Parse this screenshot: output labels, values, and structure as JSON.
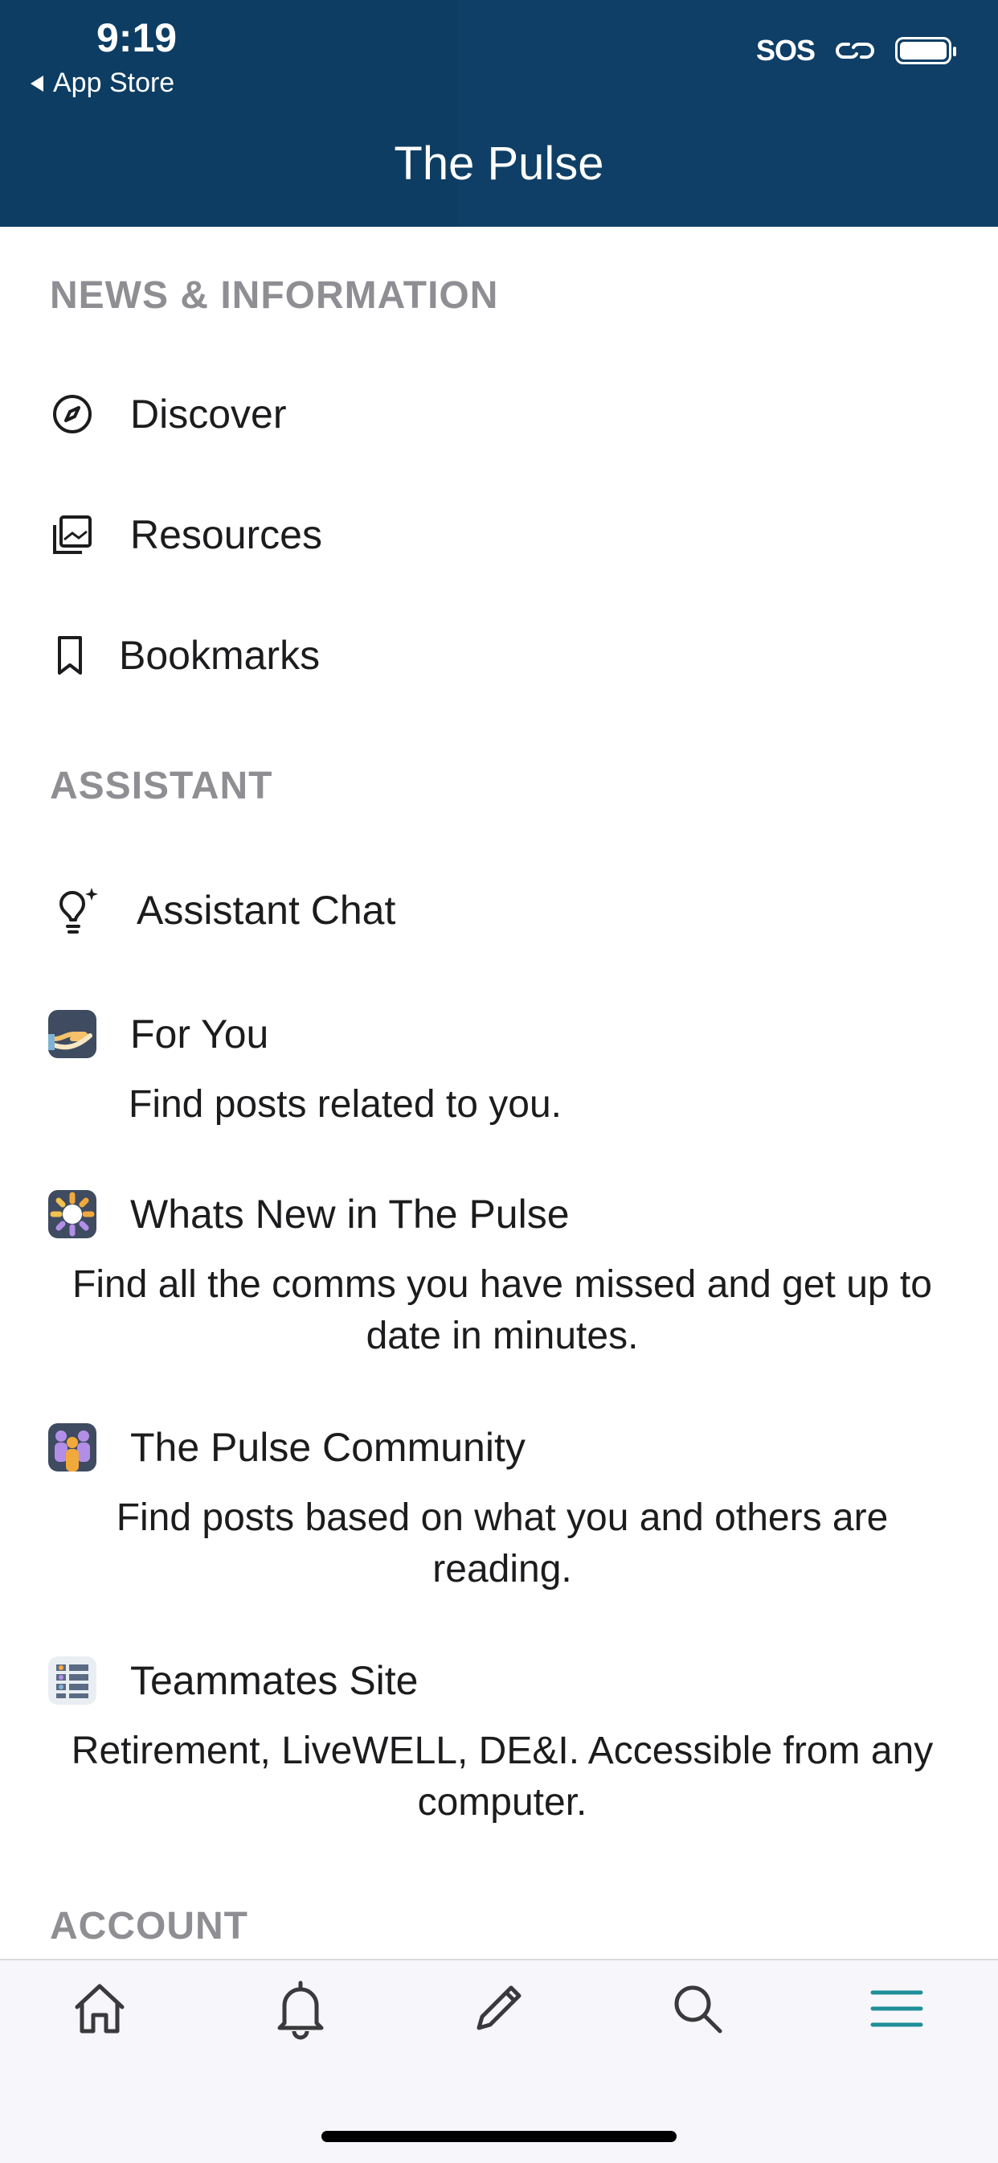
{
  "status_bar": {
    "time": "9:19",
    "back_label": "App Store",
    "sos": "SOS"
  },
  "header": {
    "title": "The Pulse"
  },
  "sections": {
    "news": {
      "title": "NEWS & INFORMATION",
      "items": [
        {
          "label": "Discover",
          "icon": "compass-icon"
        },
        {
          "label": "Resources",
          "icon": "photo-stack-icon"
        },
        {
          "label": "Bookmarks",
          "icon": "bookmark-icon"
        }
      ]
    },
    "assistant": {
      "title": "ASSISTANT",
      "items": [
        {
          "label": "Assistant Chat",
          "icon": "lightbulb-sparkle-icon"
        }
      ]
    },
    "features": [
      {
        "title": "For You",
        "desc": "Find posts related to you.",
        "icon": "hand-icon"
      },
      {
        "title": "Whats New in The Pulse",
        "desc": "Find all the comms you have missed and get up to date in minutes.",
        "icon": "sun-icon"
      },
      {
        "title": "The Pulse Community",
        "desc": "Find posts based on what you and others are reading.",
        "icon": "people-icon"
      },
      {
        "title": "Teammates Site",
        "desc": "Retirement, LiveWELL, DE&I. Accessible from any computer.",
        "icon": "grid-list-icon"
      }
    ],
    "account": {
      "title": "ACCOUNT"
    }
  },
  "tabbar": {
    "items": [
      "home-icon",
      "bell-icon",
      "pencil-icon",
      "search-icon",
      "menu-icon"
    ],
    "active": "menu-icon",
    "active_color": "#1f8f9a",
    "inactive_color": "#3a3a3c"
  },
  "colors": {
    "header_bg": "#0d3d63",
    "section_title": "#8e8e93"
  }
}
